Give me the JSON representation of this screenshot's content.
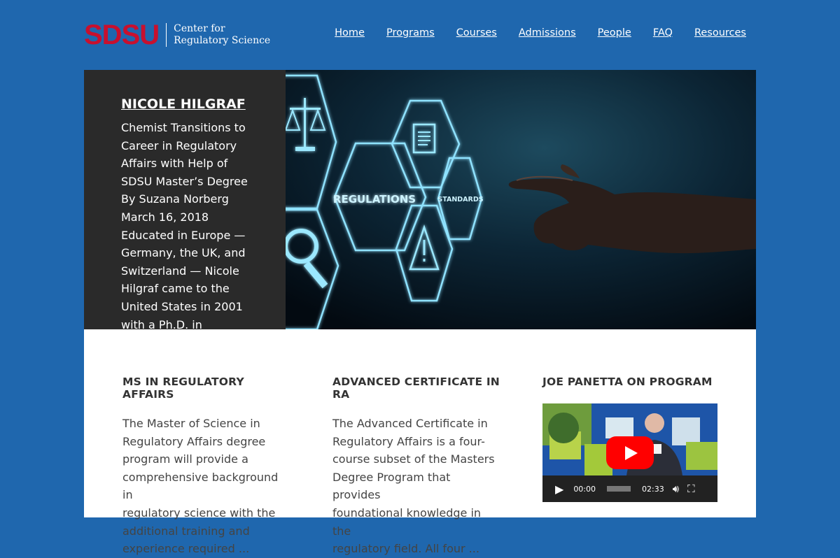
{
  "header": {
    "logo_mark": "SDSU",
    "logo_line1": "Center for",
    "logo_line2": "Regulatory Science",
    "nav": [
      "Home",
      "Programs",
      "Courses",
      "Admissions",
      "People",
      "FAQ",
      "Resources"
    ]
  },
  "hero": {
    "title": "NICOLE HILGRAF",
    "lines": [
      "Chemist Transitions to",
      "Career in Regulatory",
      "Affairs with Help of",
      "SDSU Master’s Degree",
      "By Suzana Norberg",
      "March 16, 2018",
      "Educated in Europe —",
      "Germany, the UK, and",
      "Switzerland — Nicole",
      "Hilgraf came to the",
      "United States in 2001",
      "with a Ph.D. in"
    ],
    "image_labels": {
      "regulations": "REGULATIONS",
      "standards": "STANDARDS"
    }
  },
  "columns": [
    {
      "title": "MS IN REGULATORY AFFAIRS",
      "lines": [
        "The Master of Science in",
        "Regulatory Affairs degree",
        "program will provide a",
        "comprehensive background in",
        "regulatory science with the",
        "additional training and",
        "experience required ..."
      ]
    },
    {
      "title": "ADVANCED CERTIFICATE IN RA",
      "lines": [
        "The Advanced Certificate in",
        "Regulatory Affairs is a four-",
        "course subset of the Masters",
        "Degree Program that provides",
        "foundational knowledge in the",
        "regulatory field. All four ..."
      ]
    },
    {
      "title": "JOE PANETTA ON PROGRAM"
    }
  ],
  "video": {
    "current_time": "00:00",
    "duration": "02:33",
    "progress": 0
  },
  "colors": {
    "page_bg": "#1f67ae",
    "sdsu_red": "#c8102e",
    "hero_side_bg": "#2a2a2a",
    "youtube_red": "#ff0000"
  },
  "icons": [
    "scales-icon",
    "document-icon",
    "warning-icon",
    "magnifier-icon",
    "play-icon",
    "volume-icon",
    "fullscreen-icon",
    "youtube-play-icon"
  ]
}
